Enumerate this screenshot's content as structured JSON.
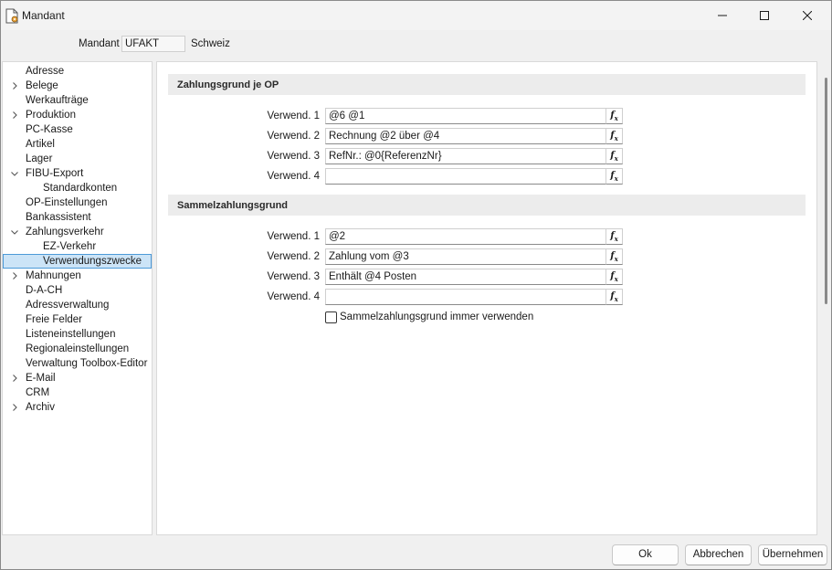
{
  "window": {
    "title": "Mandant"
  },
  "mandant": {
    "label": "Mandant",
    "code": "UFAKT",
    "name": "Schweiz"
  },
  "tree": {
    "items": [
      {
        "label": "Adresse",
        "expander": "none",
        "indent": 0
      },
      {
        "label": "Belege",
        "expander": "collapsed",
        "indent": 0
      },
      {
        "label": "Werkaufträge",
        "expander": "none",
        "indent": 0
      },
      {
        "label": "Produktion",
        "expander": "collapsed",
        "indent": 0
      },
      {
        "label": "PC-Kasse",
        "expander": "none",
        "indent": 0
      },
      {
        "label": "Artikel",
        "expander": "none",
        "indent": 0
      },
      {
        "label": "Lager",
        "expander": "none",
        "indent": 0
      },
      {
        "label": "FIBU-Export",
        "expander": "expanded",
        "indent": 0
      },
      {
        "label": "Standardkonten",
        "expander": "none",
        "indent": 1
      },
      {
        "label": "OP-Einstellungen",
        "expander": "none",
        "indent": 0
      },
      {
        "label": "Bankassistent",
        "expander": "none",
        "indent": 0
      },
      {
        "label": "Zahlungsverkehr",
        "expander": "expanded",
        "indent": 0
      },
      {
        "label": "EZ-Verkehr",
        "expander": "none",
        "indent": 1
      },
      {
        "label": "Verwendungszwecke",
        "expander": "none",
        "indent": 1,
        "selected": true
      },
      {
        "label": "Mahnungen",
        "expander": "collapsed",
        "indent": 0
      },
      {
        "label": "D-A-CH",
        "expander": "none",
        "indent": 0
      },
      {
        "label": "Adressverwaltung",
        "expander": "none",
        "indent": 0
      },
      {
        "label": "Freie Felder",
        "expander": "none",
        "indent": 0
      },
      {
        "label": "Listeneinstellungen",
        "expander": "none",
        "indent": 0
      },
      {
        "label": "Regionaleinstellungen",
        "expander": "none",
        "indent": 0
      },
      {
        "label": "Verwaltung Toolbox-Editor",
        "expander": "none",
        "indent": 0
      },
      {
        "label": "E-Mail",
        "expander": "collapsed",
        "indent": 0
      },
      {
        "label": "CRM",
        "expander": "none",
        "indent": 0
      },
      {
        "label": "Archiv",
        "expander": "collapsed",
        "indent": 0
      }
    ]
  },
  "sections": [
    {
      "title": "Zahlungsgrund je OP",
      "fields": [
        {
          "label": "Verwend. 1",
          "value": "@6 @1"
        },
        {
          "label": "Verwend. 2",
          "value": "Rechnung @2 über @4"
        },
        {
          "label": "Verwend. 3",
          "value": "RefNr.: @0{ReferenzNr}"
        },
        {
          "label": "Verwend. 4",
          "value": ""
        }
      ]
    },
    {
      "title": "Sammelzahlungsgrund",
      "fields": [
        {
          "label": "Verwend. 1",
          "value": "@2"
        },
        {
          "label": "Verwend. 2",
          "value": "Zahlung vom @3"
        },
        {
          "label": "Verwend. 3",
          "value": "Enthält @4 Posten"
        },
        {
          "label": "Verwend. 4",
          "value": ""
        }
      ]
    }
  ],
  "fx_label": "fx",
  "checkbox": {
    "label": "Sammelzahlungsgrund immer verwenden",
    "checked": false
  },
  "buttons": {
    "ok": "Ok",
    "cancel": "Abbrechen",
    "apply": "Übernehmen"
  }
}
